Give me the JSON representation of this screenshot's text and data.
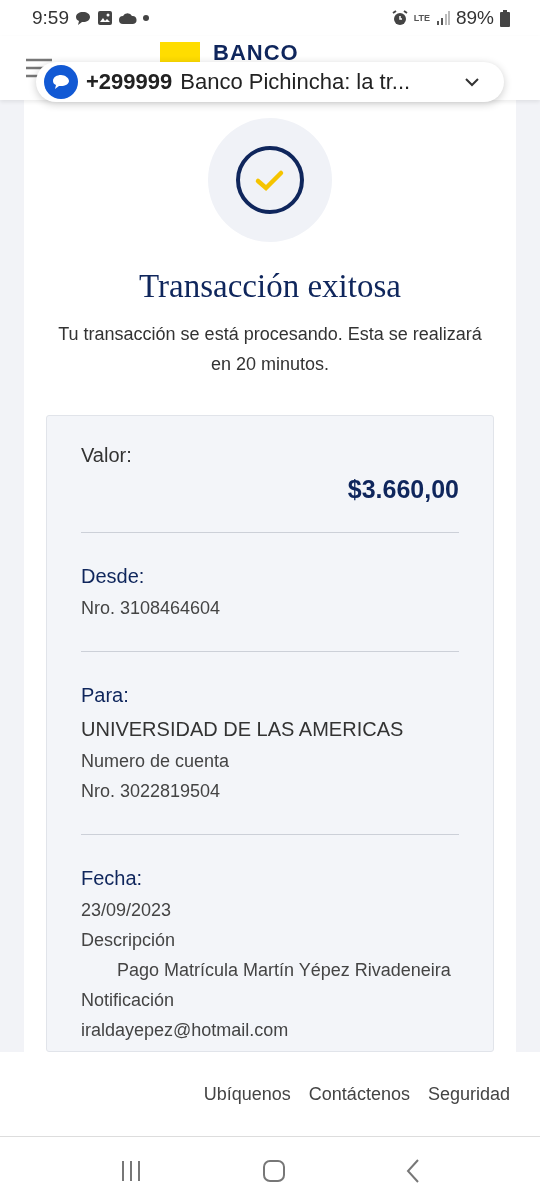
{
  "status_bar": {
    "time": "9:59",
    "network": "LTE",
    "battery": "89%"
  },
  "header": {
    "logo_text": "BANCO"
  },
  "notification": {
    "sender": "+299999",
    "text": "Banco Pichincha: la tr..."
  },
  "result": {
    "title": "Transacción exitosa",
    "message": "Tu transacción se está procesando. Esta se realizará en 20 minutos."
  },
  "details": {
    "amount_label": "Valor:",
    "amount": "$3.660,00",
    "sections": [
      {
        "rows": [
          {
            "kind": "heading",
            "text": "Desde:"
          },
          {
            "kind": "text",
            "text": "Nro. 3108464604"
          }
        ]
      },
      {
        "rows": [
          {
            "kind": "heading",
            "text": "Para:"
          },
          {
            "kind": "name",
            "text": "UNIVERSIDAD DE LAS AMERICAS"
          },
          {
            "kind": "text",
            "text": "Numero de cuenta"
          },
          {
            "kind": "text",
            "text": "Nro. 3022819504"
          }
        ]
      },
      {
        "rows": [
          {
            "kind": "heading",
            "text": "Fecha:"
          },
          {
            "kind": "text",
            "text": "23/09/2023"
          },
          {
            "kind": "text",
            "text": "Descripción"
          },
          {
            "kind": "indent",
            "text": "Pago Matrícula Martín Yépez Rivadeneira"
          },
          {
            "kind": "text",
            "text": "Notificación"
          },
          {
            "kind": "text",
            "text": "iraldayepez@hotmail.com"
          }
        ]
      }
    ]
  },
  "footer": {
    "links": [
      "Ubíquenos",
      "Contáctenos",
      "Seguridad"
    ]
  }
}
